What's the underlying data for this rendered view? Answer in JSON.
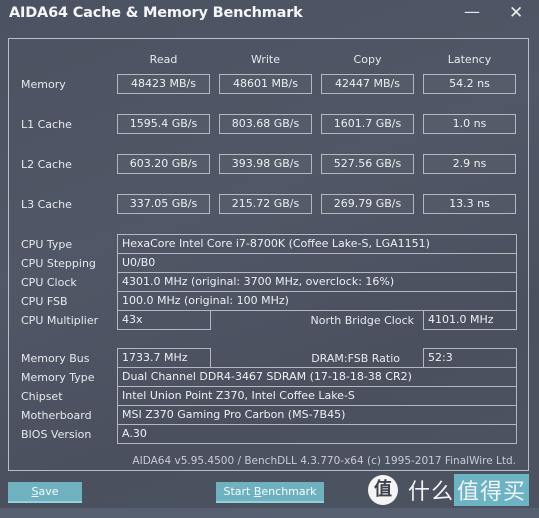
{
  "window": {
    "title": "AIDA64 Cache & Memory Benchmark",
    "minimize_icon": "minimize-icon",
    "close_icon": "close-icon"
  },
  "columns": [
    "Read",
    "Write",
    "Copy",
    "Latency"
  ],
  "bench_rows": [
    {
      "label": "Memory",
      "values": [
        "48423 MB/s",
        "48601 MB/s",
        "42447 MB/s",
        "54.2 ns"
      ]
    },
    {
      "label": "L1 Cache",
      "values": [
        "1595.4 GB/s",
        "803.68 GB/s",
        "1601.7 GB/s",
        "1.0 ns"
      ]
    },
    {
      "label": "L2 Cache",
      "values": [
        "603.20 GB/s",
        "393.98 GB/s",
        "527.56 GB/s",
        "2.9 ns"
      ]
    },
    {
      "label": "L3 Cache",
      "values": [
        "337.05 GB/s",
        "215.72 GB/s",
        "269.79 GB/s",
        "13.3 ns"
      ]
    }
  ],
  "cpu_info": {
    "cpu_type": {
      "label": "CPU Type",
      "value": "HexaCore Intel Core i7-8700K  (Coffee Lake-S, LGA1151)"
    },
    "cpu_stepping": {
      "label": "CPU Stepping",
      "value": "U0/B0"
    },
    "cpu_clock": {
      "label": "CPU Clock",
      "value": "4301.0 MHz  (original: 3700 MHz, overclock: 16%)"
    },
    "cpu_fsb": {
      "label": "CPU FSB",
      "value": "100.0 MHz  (original: 100 MHz)"
    },
    "cpu_multiplier": {
      "label": "CPU Multiplier",
      "value": "43x"
    },
    "north_bridge_clock": {
      "label": "North Bridge Clock",
      "value": "4101.0 MHz"
    }
  },
  "memory_info": {
    "memory_bus": {
      "label": "Memory Bus",
      "value": "1733.7 MHz"
    },
    "dram_fsb_ratio": {
      "label": "DRAM:FSB Ratio",
      "value": "52:3"
    },
    "memory_type": {
      "label": "Memory Type",
      "value": "Dual Channel DDR4-3467 SDRAM  (17-18-18-38 CR2)"
    },
    "chipset": {
      "label": "Chipset",
      "value": "Intel Union Point Z370, Intel Coffee Lake-S"
    },
    "motherboard": {
      "label": "Motherboard",
      "value": "MSI Z370 Gaming Pro Carbon (MS-7B45)"
    },
    "bios_version": {
      "label": "BIOS Version",
      "value": "A.30"
    }
  },
  "footer": "AIDA64 v5.95.4500 / BenchDLL 4.3.770-x64  (c) 1995-2017 FinalWire Ltd.",
  "buttons": {
    "save": {
      "accel": "S",
      "rest": "ave"
    },
    "start_benchmark": {
      "pre": "Start ",
      "accel": "B",
      "rest": "enchmark"
    }
  },
  "watermark": {
    "circle": "值",
    "text1": "什么",
    "text2": "值得买"
  },
  "colors": {
    "background": "#4d5463",
    "button": "#70b1c0",
    "border": "#b3b7bf"
  }
}
